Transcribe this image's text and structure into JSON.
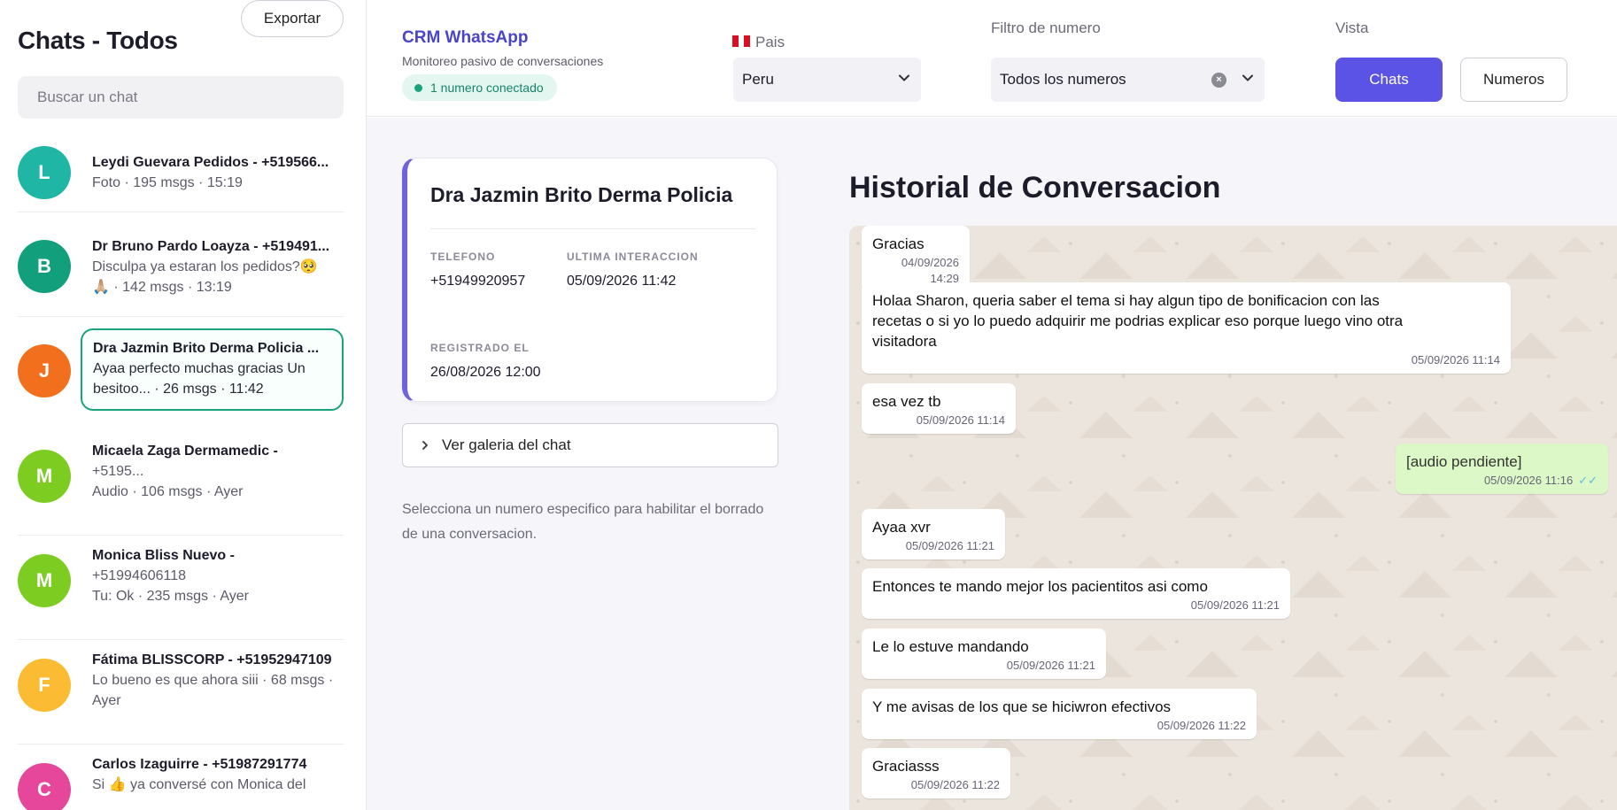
{
  "sidebar": {
    "title": "Chats - Todos",
    "export_label": "Exportar",
    "search_placeholder": "Buscar un chat",
    "chats": [
      {
        "initial": "L",
        "color": "#1fb6a6",
        "name": "Leydi Guevara Pedidos - +5195​66...",
        "sub1": "Foto · 195 msgs · 15:19",
        "sub2": ""
      },
      {
        "initial": "B",
        "color": "#11a07b",
        "name": "Dr Bruno Pardo Loayza - +519491...",
        "sub1": "Disculpa ya estaran los pedidos?🥺",
        "sub2": "🙏🏼 · 142 msgs · 13:19"
      },
      {
        "initial": "J",
        "color": "#f26f1e",
        "name": "Dra Jazmin Brito Derma Policia ...",
        "sub1": "Ayaa perfecto muchas gracias Un",
        "sub2": "besitoo... · 26 msgs · 11:42"
      },
      {
        "initial": "M",
        "color": "#7ccc22",
        "name": "Micaela Zaga Dermamedic -",
        "sub1": "+5195...",
        "sub2": "Audio · 106 msgs · Ayer"
      },
      {
        "initial": "M",
        "color": "#7ccc22",
        "name": "Monica Bliss Nuevo -",
        "sub1": "+51994606118",
        "sub2": "Tu: Ok · 235 msgs · Ayer"
      },
      {
        "initial": "F",
        "color": "#fbbc33",
        "name": "Fátima BLISSCORP - +51952947109",
        "sub1": "Lo bueno es que ahora siii · 68 msgs ·",
        "sub2": "Ayer"
      },
      {
        "initial": "C",
        "color": "#e6479b",
        "name": "Carlos Izaguirre - +51987291774",
        "sub1": "Si 👍 ya conversé con Monica del",
        "sub2": ""
      }
    ]
  },
  "header": {
    "brand_title": "CRM WhatsApp",
    "brand_sub": "Monitoreo pasivo de conversaciones",
    "connected_badge": "1 numero conectado",
    "country_label": "Pais",
    "country_value": "Peru",
    "number_filter_label": "Filtro de numero",
    "number_filter_value": "Todos los numeros",
    "view_label": "Vista",
    "view_chats": "Chats",
    "view_numbers": "Numeros",
    "accent_color": "#5b52e6"
  },
  "contact": {
    "name": "Dra Jazmin Brito Derma Policia",
    "phone_label": "TELEFONO",
    "phone": "+51949920957",
    "last_label": "ULTIMA INTERACCION",
    "last": "05/09/2026 11:42",
    "registered_label": "REGISTRADO EL",
    "registered": "26/08/2026 12:00",
    "gallery_label": "Ver galeria del chat",
    "hint": "Selecciona un numero especifico para habilitar el borrado de una conversacion."
  },
  "history": {
    "title": "Historial de Conversacion",
    "messages": [
      {
        "dir": "in",
        "text": "Gracias",
        "time": "04/09/2026 14:29"
      },
      {
        "dir": "in",
        "text": "Holaa Sharon, queria saber el tema si hay algun tipo de bonificacion con las recetas o si yo lo puedo adquirir me podrias explicar eso porque luego vino otra visitadora",
        "time": "05/09/2026 11:14"
      },
      {
        "dir": "in",
        "text": "esa vez tb",
        "time": "05/09/2026 11:14"
      },
      {
        "dir": "out",
        "text": "[audio pendiente]",
        "time": "05/09/2026 11:16",
        "ticks": "✓✓"
      },
      {
        "dir": "in",
        "text": "Ayaa xvr",
        "time": "05/09/2026 11:21"
      },
      {
        "dir": "in",
        "text": "Entonces te mando mejor los pacientitos asi como",
        "time": "05/09/2026 11:21"
      },
      {
        "dir": "in",
        "text": "Le lo estuve mandando",
        "time": "05/09/2026 11:21"
      },
      {
        "dir": "in",
        "text": "Y me avisas de los que se hiciwron efectivos",
        "time": "05/09/2026 11:22"
      },
      {
        "dir": "in",
        "text": "Graciasss",
        "time": "05/09/2026 11:22"
      }
    ]
  }
}
